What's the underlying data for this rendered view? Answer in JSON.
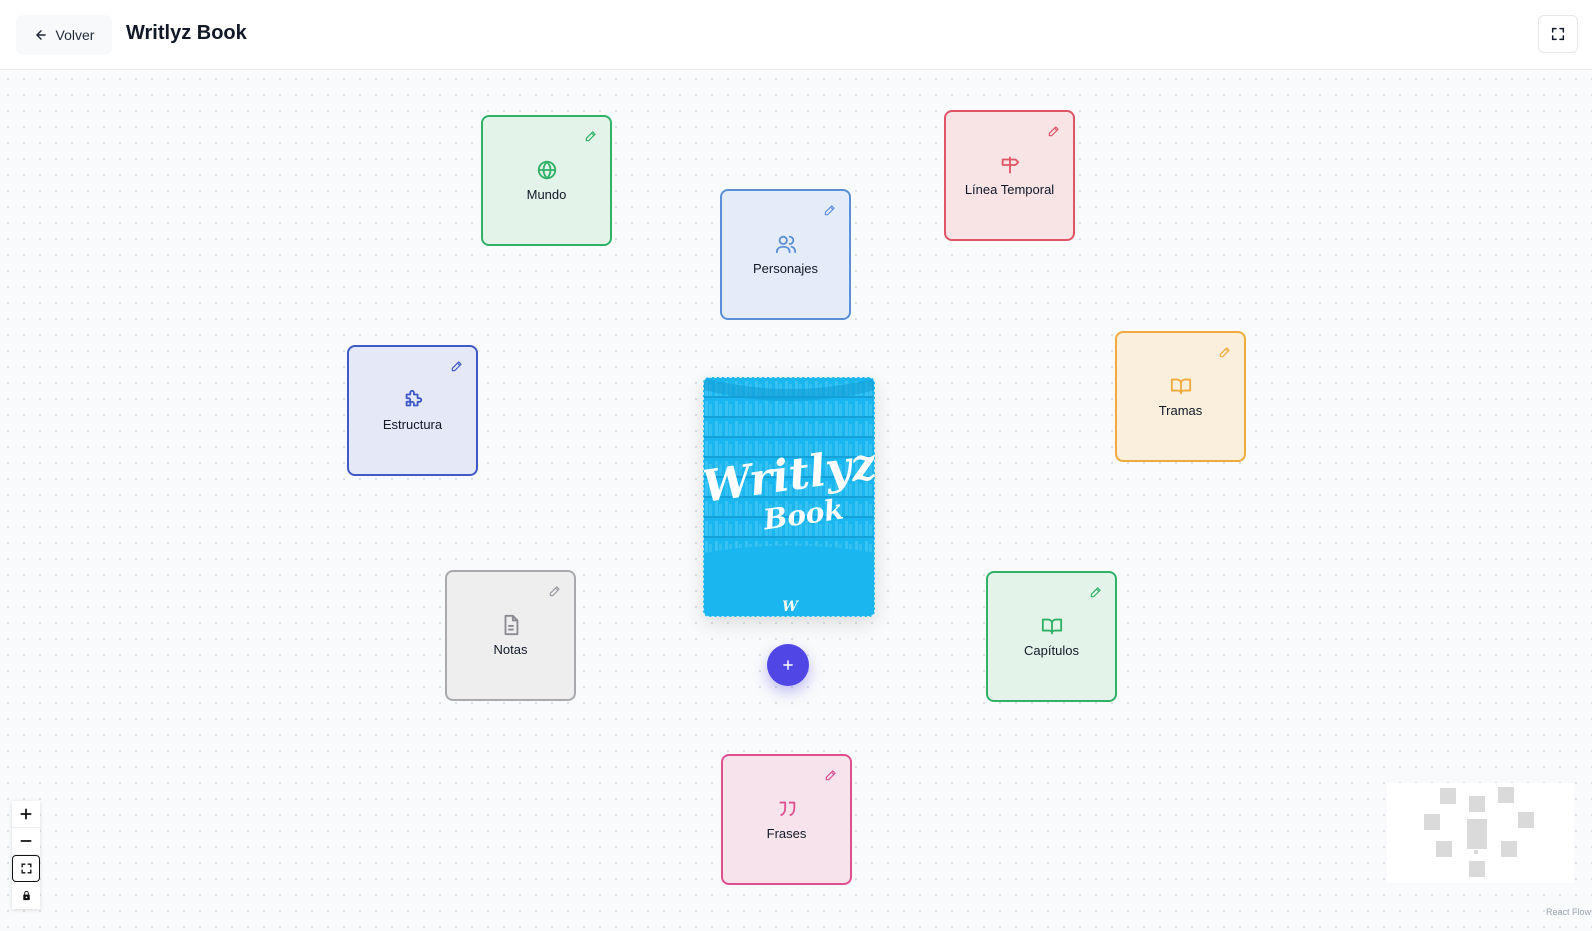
{
  "header": {
    "back_label": "Volver",
    "title": "Writlyz Book"
  },
  "nodes": {
    "mundo": {
      "label": "Mundo",
      "icon": "globe-icon",
      "color": "#2fb167"
    },
    "personajes": {
      "label": "Personajes",
      "icon": "users-icon",
      "color": "#5a8fd8"
    },
    "linea": {
      "label": "Línea Temporal",
      "icon": "signpost-icon",
      "color": "#e05565"
    },
    "estructura": {
      "label": "Estructura",
      "icon": "puzzle-icon",
      "color": "#3f5ac6"
    },
    "tramas": {
      "label": "Tramas",
      "icon": "book-open-icon",
      "color": "#f0aa3e"
    },
    "notas": {
      "label": "Notas",
      "icon": "file-icon",
      "color": "#a8a8ad"
    },
    "capitulos": {
      "label": "Capítulos",
      "icon": "book-open-icon",
      "color": "#2fb167"
    },
    "frases": {
      "label": "Frases",
      "icon": "quote-icon",
      "color": "#df4f8f"
    }
  },
  "cover": {
    "title_line1": "Writlyz",
    "title_line2": "Book",
    "monogram": "W",
    "color": "#1ab6ef"
  },
  "controls": {
    "zoom_in": "+",
    "zoom_out": "−"
  },
  "attribution": "React Flow",
  "accent": "#4f46e5"
}
